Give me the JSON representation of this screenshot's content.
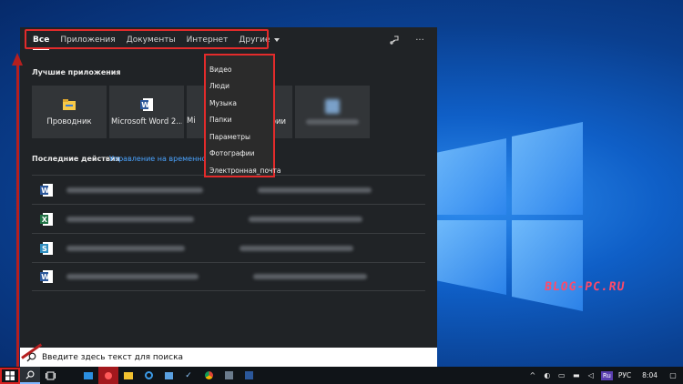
{
  "tabs": [
    {
      "label": "Все",
      "active": true
    },
    {
      "label": "Приложения"
    },
    {
      "label": "Документы"
    },
    {
      "label": "Интернет"
    },
    {
      "label": "Другие"
    }
  ],
  "header_icons": [
    "feedback-icon",
    "more-icon"
  ],
  "best_apps": {
    "title": "Лучшие приложения",
    "items": [
      {
        "label": "Проводник",
        "icon": "file-explorer-icon"
      },
      {
        "label": "Microsoft Word 2...",
        "icon": "word-icon"
      },
      {
        "label": "Mi",
        "icon": "app-icon"
      },
      {
        "label": "",
        "icon": "app-icon"
      },
      {
        "label": "Фотографии",
        "icon": "photos-icon"
      },
      {
        "label": "",
        "icon": "blurred-app-icon"
      }
    ]
  },
  "recent": {
    "title": "Последние действия",
    "link": "Управление на временной ш",
    "items": [
      {
        "icon": "word-doc-icon"
      },
      {
        "icon": "excel-doc-icon"
      },
      {
        "icon": "sway-doc-icon"
      },
      {
        "icon": "word-doc-icon"
      }
    ]
  },
  "dropdown": {
    "items": [
      "Видео",
      "Люди",
      "Музыка",
      "Папки",
      "Параметры",
      "Фотографии",
      "Электронная_почта"
    ]
  },
  "search": {
    "placeholder": "Введите здесь текст для поиска"
  },
  "watermark": "BLOG-PC.RU",
  "tray": {
    "lang": "РУС",
    "time": "8:04",
    "ime": "Ru"
  },
  "colors": {
    "annotation": "#e32b2b",
    "accent": "#4aa3ff"
  }
}
